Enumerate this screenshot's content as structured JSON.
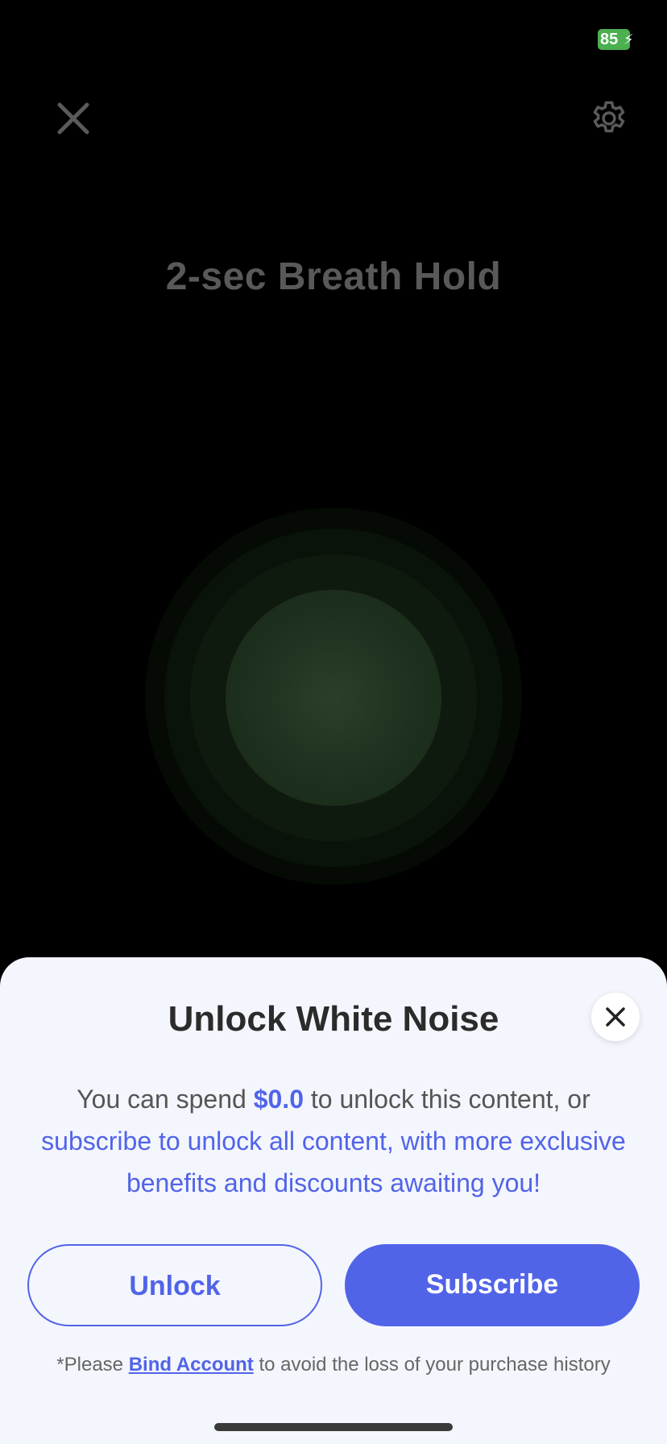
{
  "status_bar": {
    "battery_level": "85",
    "battery_color": "#4caf50"
  },
  "header": {
    "close_icon": "close-icon",
    "settings_icon": "gear-icon"
  },
  "exercise": {
    "title": "2-sec Breath Hold"
  },
  "sheet": {
    "title": "Unlock White Noise",
    "body_prefix": "You can spend ",
    "price": "$0.0",
    "body_middle": " to unlock this content, or",
    "body_blue": "subscribe to unlock all content, with more exclusive benefits and discounts awaiting you!",
    "unlock_label": "Unlock",
    "subscribe_label": "Subscribe",
    "footnote_prefix": "*Please ",
    "footnote_link": "Bind Account",
    "footnote_suffix": " to avoid the loss of your purchase history",
    "accent_color": "#5164e8"
  }
}
